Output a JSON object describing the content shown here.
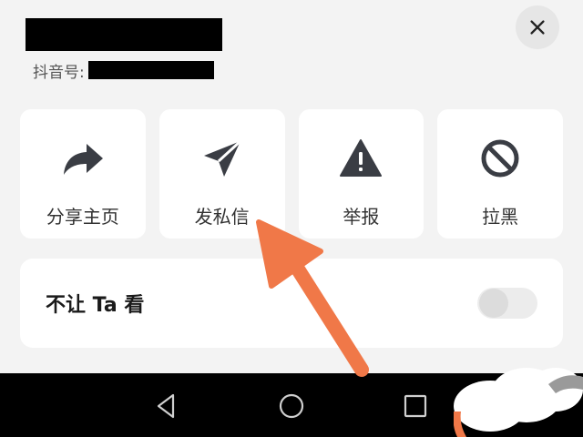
{
  "header": {
    "account_label": "抖音号:"
  },
  "actions": [
    {
      "label": "分享主页",
      "icon": "share-arrow-icon"
    },
    {
      "label": "发私信",
      "icon": "send-message-icon"
    },
    {
      "label": "举报",
      "icon": "warning-icon"
    },
    {
      "label": "拉黑",
      "icon": "block-icon"
    }
  ],
  "block_row": {
    "label": "不让 Ta 看",
    "toggle_on": false
  },
  "colors": {
    "annotation_arrow": "#f07848",
    "icon": "#3a3d44",
    "card": "#ffffff",
    "background": "#f3f3f3"
  }
}
